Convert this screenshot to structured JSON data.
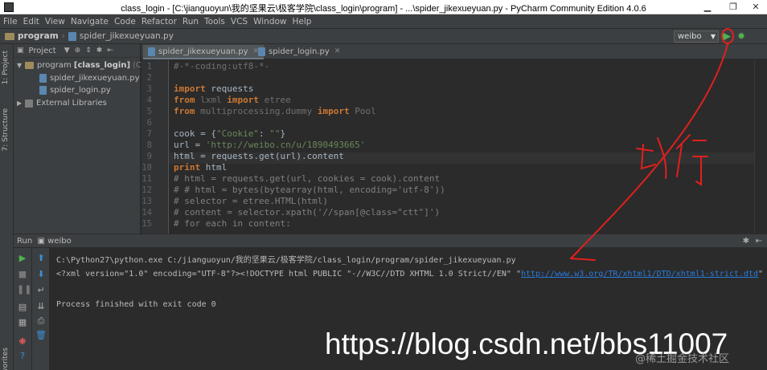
{
  "window": {
    "title": "class_login - [C:\\jianguoyun\\我的坚果云\\极客学院\\class_login\\program] - ...\\spider_jikexueyuan.py - PyCharm Community Edition 4.0.6",
    "minimize": "▁",
    "maximize": "❐",
    "close": "✕"
  },
  "menu": [
    "File",
    "Edit",
    "View",
    "Navigate",
    "Code",
    "Refactor",
    "Run",
    "Tools",
    "VCS",
    "Window",
    "Help"
  ],
  "navbar": {
    "crumbs": [
      "program",
      "spider_jikexueyuan.py"
    ],
    "run_config": "weibo"
  },
  "toolstrip": {
    "project_tab": "1: Project",
    "structure_tab": "7: Structure",
    "favorites_tab": "Favorites"
  },
  "project": {
    "header": "Project",
    "tree": [
      {
        "label": "program",
        "bold": "[class_login]",
        "path": "(C:\\jia"
      },
      {
        "label": "spider_jikexueyuan.py"
      },
      {
        "label": "spider_login.py"
      },
      {
        "label": "External Libraries"
      }
    ]
  },
  "tabs": [
    "spider_jikexueyuan.py",
    "spider_login.py"
  ],
  "editor": {
    "line_numbers": [
      "1",
      "2",
      "3",
      "4",
      "5",
      "6",
      "7",
      "8",
      "9",
      "10",
      "11",
      "12",
      "13",
      "14",
      "15"
    ]
  },
  "run": {
    "header": "Run",
    "config": "weibo",
    "console": {
      "line1": "C:\\Python27\\python.exe C:/jianguoyun/我的坚果云/极客学院/class_login/program/spider_jikexueyuan.py",
      "line2_text": "<?xml version=\"1.0\" encoding=\"UTF-8\"?><!DOCTYPE html PUBLIC \"-//W3C//DTD XHTML 1.0 Strict//EN\" \"",
      "line2_link": "http://www.w3.org/TR/xhtml1/DTD/xhtml1-strict.dtd",
      "line2_end": "\"",
      "line3": "Process finished with exit code 0"
    }
  },
  "annotation": {
    "handwritten": "运行"
  },
  "watermark": {
    "main": "https://blog.csdn.net/bbs11007",
    "sub": "@稀土掘金技术社区"
  },
  "colors": {
    "keyword": "#cc7832",
    "string": "#6a8759",
    "comment": "#808080",
    "annotation": "#e0201e",
    "link": "#287bde"
  }
}
